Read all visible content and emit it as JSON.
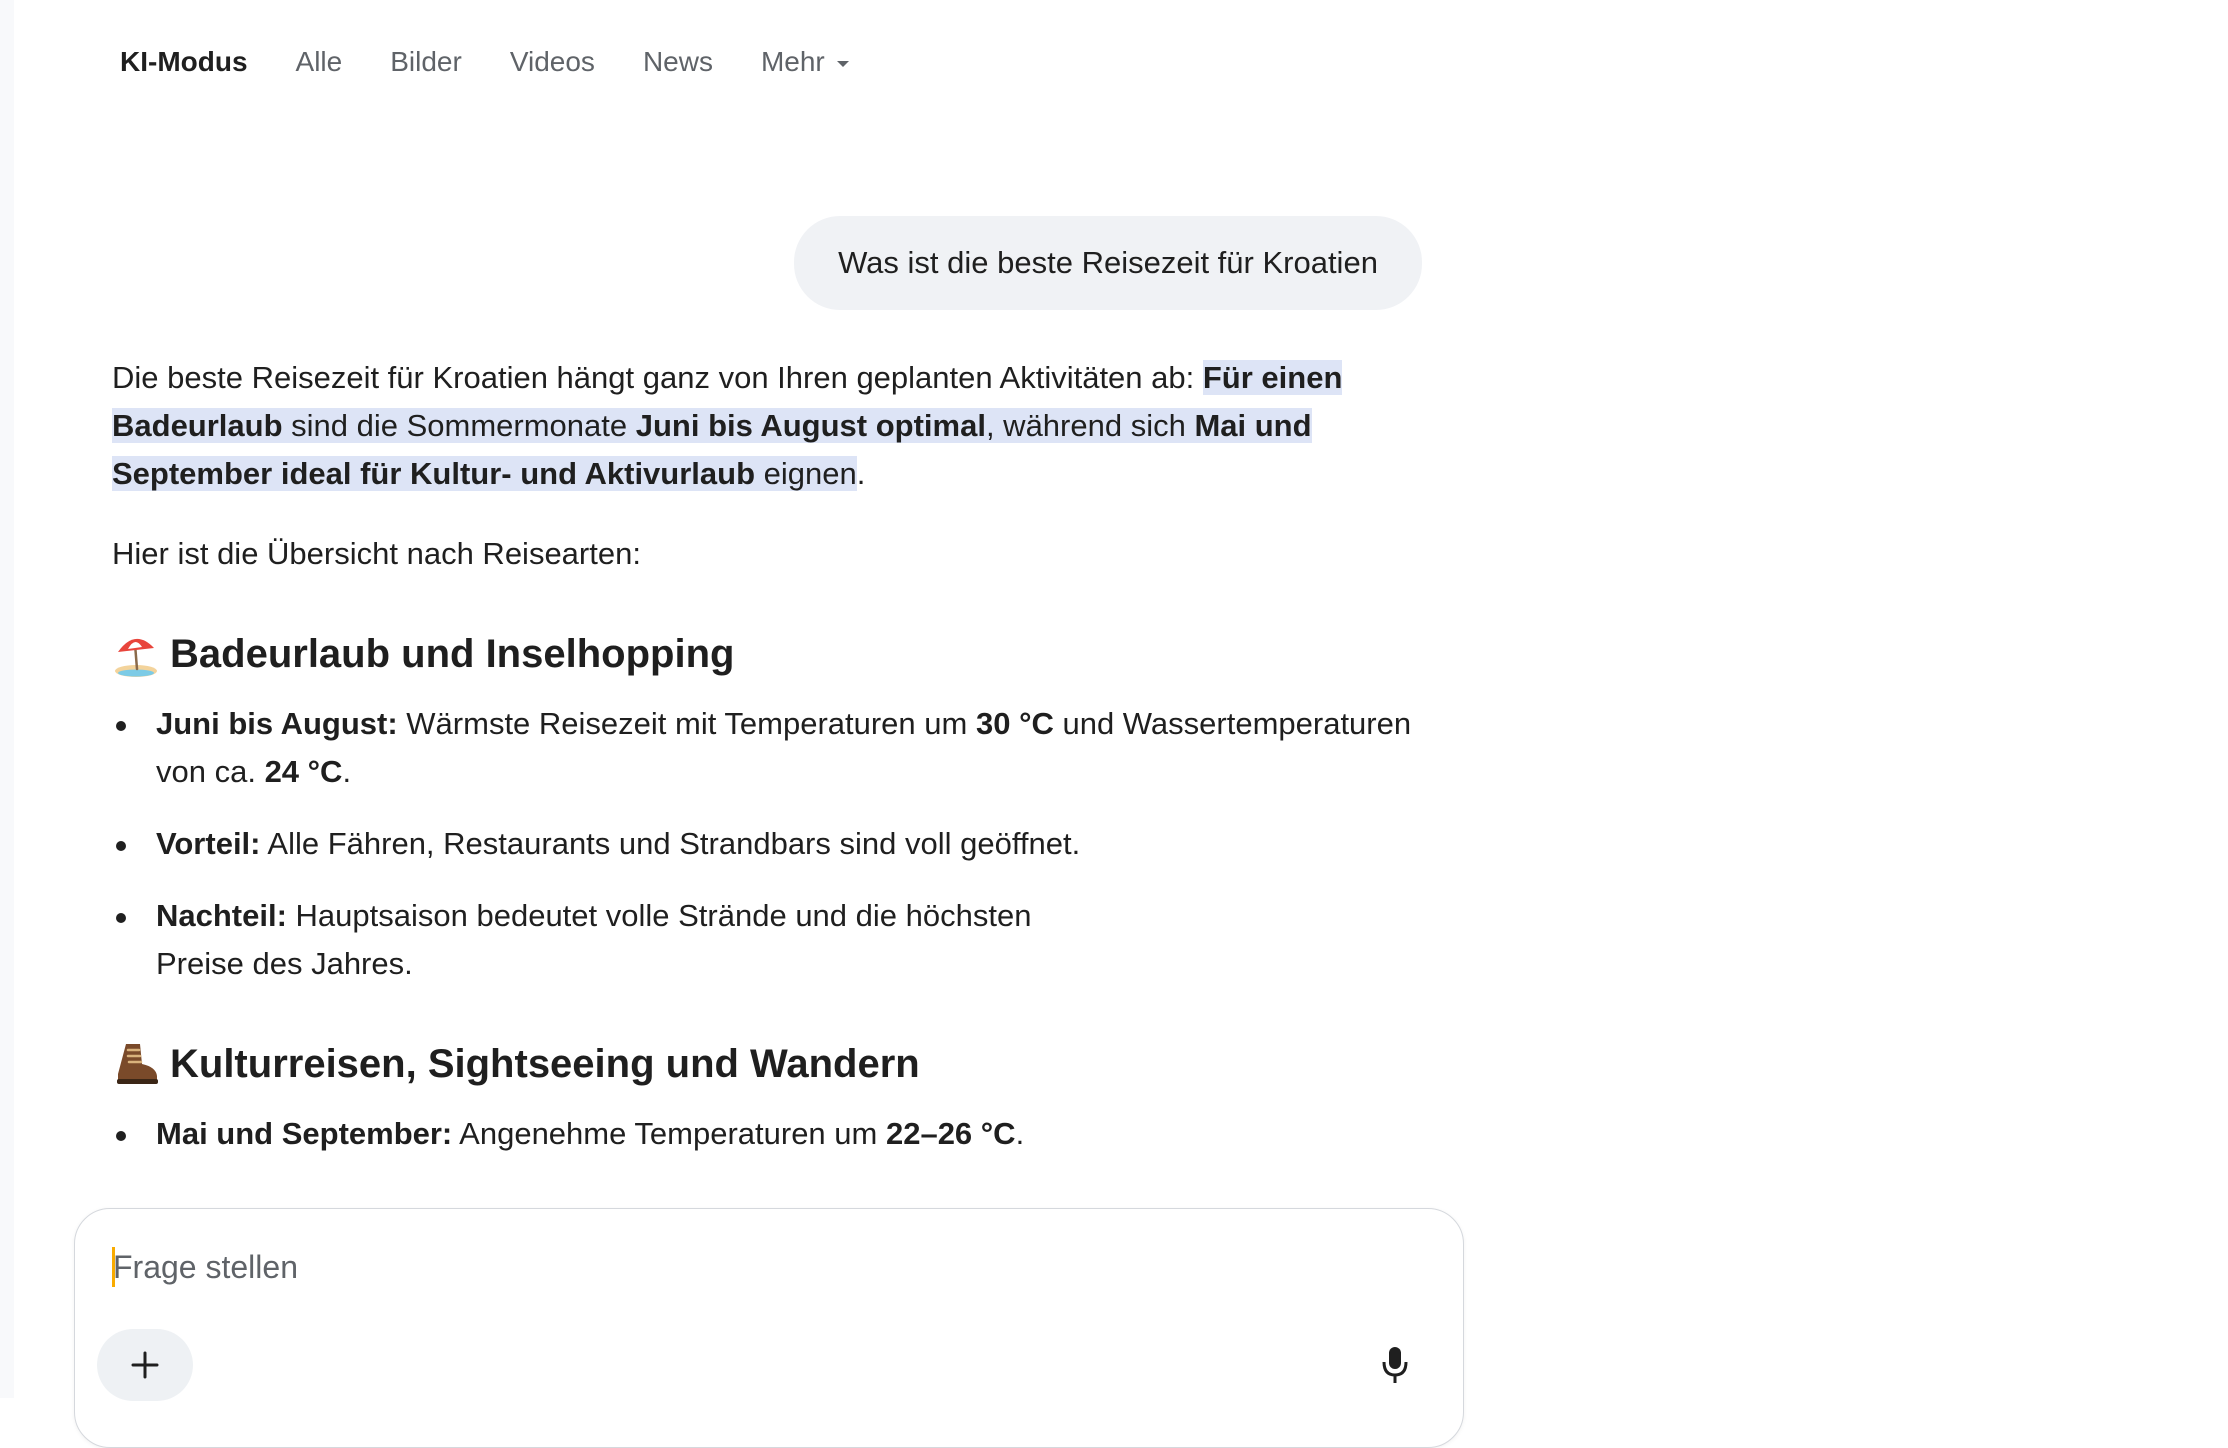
{
  "nav": {
    "tabs": [
      {
        "label": "KI-Modus",
        "active": true
      },
      {
        "label": "Alle"
      },
      {
        "label": "Bilder"
      },
      {
        "label": "Videos"
      },
      {
        "label": "News"
      },
      {
        "label": "Mehr"
      }
    ]
  },
  "query": "Was ist die beste Reisezeit für Kroatien",
  "answer": {
    "p1": {
      "t1": "Die beste Reisezeit für Kroatien hängt ganz von Ihren geplanten Aktivitäten ab: ",
      "b1": "Für einen Badeurlaub",
      "t2": " sind die Sommermonate ",
      "b2": "Juni bis August optimal",
      "t3": ", während sich ",
      "b3": "Mai und September ideal für Kultur- und Aktivurlaub",
      "t4": " eignen",
      "t5": "."
    },
    "intro": "Hier ist die Übersicht nach Reisearten:",
    "section1": {
      "icon": "beach-umbrella-icon",
      "title": "Badeurlaub und Inselhopping",
      "items": [
        {
          "label": "Juni bis August:",
          "t1": " Wärmste Reisezeit mit Temperaturen um ",
          "v1": "30 °C",
          "t2": " und Wassertemperaturen von ca. ",
          "v2": "24 °C",
          "t3": "."
        },
        {
          "label": "Vorteil:",
          "text": " Alle Fähren, Restaurants und Strandbars sind voll geöffnet."
        },
        {
          "label": "Nachteil:",
          "text": " Hauptsaison bedeutet volle Strände und die höchsten Preise des Jahres."
        }
      ]
    },
    "section2": {
      "icon": "hiking-boot-icon",
      "title": "Kulturreisen, Sightseeing und Wandern",
      "items": [
        {
          "label": "Mai und September:",
          "t1": " Angenehme Temperaturen um ",
          "v1": "22–26 °C",
          "t2": "."
        }
      ]
    }
  },
  "composer": {
    "placeholder": "Frage stellen",
    "plus_icon": "plus-icon",
    "mic_icon": "microphone-icon"
  },
  "colors": {
    "highlight": "#dde4f6",
    "bubble": "#f0f2f5",
    "text": "#1f1f1f",
    "muted": "#5f6368",
    "cursor": "#f9ab00"
  }
}
